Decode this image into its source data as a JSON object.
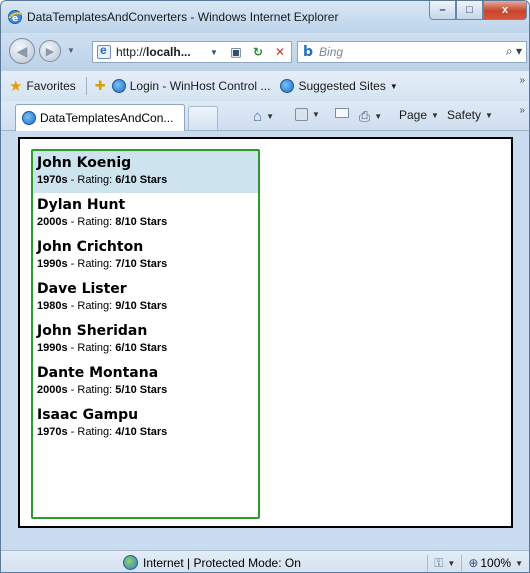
{
  "window": {
    "title": "DataTemplatesAndConverters - Windows Internet Explorer",
    "controls": {
      "minimize": "–",
      "maximize": "□",
      "close": "x"
    }
  },
  "address_bar": {
    "url_prefix": "http://",
    "url_host": "localh...",
    "search_placeholder": "Bing"
  },
  "favorites_bar": {
    "favorites_label": "Favorites",
    "items": [
      {
        "label": "Login - WinHost Control ..."
      },
      {
        "label": "Suggested Sites"
      }
    ]
  },
  "tabs": [
    {
      "label": "DataTemplatesAndCon..."
    }
  ],
  "command_bar": {
    "page_label": "Page",
    "safety_label": "Safety"
  },
  "list": {
    "detail_sep": " - Rating: ",
    "items": [
      {
        "name": "John Koenig",
        "decade": "1970s",
        "rating": "6/10 Stars",
        "selected": true
      },
      {
        "name": "Dylan Hunt",
        "decade": "2000s",
        "rating": "8/10 Stars",
        "selected": false
      },
      {
        "name": "John Crichton",
        "decade": "1990s",
        "rating": "7/10 Stars",
        "selected": false
      },
      {
        "name": "Dave Lister",
        "decade": "1980s",
        "rating": "9/10 Stars",
        "selected": false
      },
      {
        "name": "John Sheridan",
        "decade": "1990s",
        "rating": "6/10 Stars",
        "selected": false
      },
      {
        "name": "Dante Montana",
        "decade": "2000s",
        "rating": "5/10 Stars",
        "selected": false
      },
      {
        "name": "Isaac Gampu",
        "decade": "1970s",
        "rating": "4/10 Stars",
        "selected": false
      }
    ]
  },
  "status_bar": {
    "zone": "Internet | Protected Mode: On",
    "zoom": "100%"
  },
  "colors": {
    "list_border": "#2e9a2e",
    "selected_row": "#cde3ee"
  }
}
